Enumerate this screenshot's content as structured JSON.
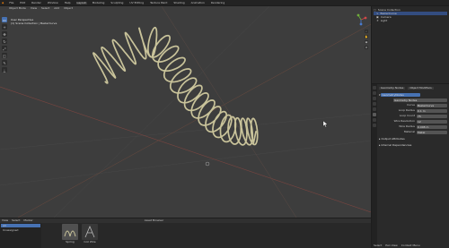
{
  "menu": {
    "items": [
      "File",
      "Edit",
      "Render",
      "Window",
      "Help",
      "Layout",
      "Modeling",
      "Sculpting",
      "UV Editing",
      "Texture Paint",
      "Shading",
      "Animation",
      "Rendering"
    ],
    "active_index": 5
  },
  "viewport": {
    "header_items": [
      "Object Mode",
      "View",
      "Select",
      "Add",
      "Object"
    ],
    "info_line1": "User Perspective",
    "info_line2": "(1) Scene Collection | BezierCurve"
  },
  "outliner": {
    "rows": [
      {
        "label": "Scene Collection",
        "selected": false
      },
      {
        "label": "BezierCurve",
        "selected": true
      },
      {
        "label": "Camera",
        "selected": false
      },
      {
        "label": "Light",
        "selected": false
      }
    ]
  },
  "properties": {
    "top_tabs": [
      "Geometry Nodes",
      "Object Modifiers"
    ],
    "modifier_name": "GeometryNodes",
    "node_group": "Geometry Nodes",
    "inputs": [
      {
        "label": "Curve",
        "value": "BezierCurve"
      },
      {
        "label": "Loop Radius",
        "value": "0.1 m"
      },
      {
        "label": "Loop Count",
        "value": "75"
      },
      {
        "label": "Wire Resolution",
        "value": "12"
      },
      {
        "label": "Wire Radius",
        "value": "0.008 m"
      },
      {
        "label": "Material",
        "value": "Metal"
      }
    ],
    "sections": [
      "Output Attributes",
      "Internal Dependencies"
    ]
  },
  "timeline": {
    "header_items": [
      "View",
      "Select",
      "Marker"
    ],
    "center_label": "Asset Browser",
    "left_items": [
      "All",
      "Unassigned"
    ],
    "assets": [
      "Spring",
      "Coil Wire"
    ]
  },
  "status": {
    "items": [
      "Select",
      "Pan View",
      "Context Menu"
    ]
  },
  "colors": {
    "accent": "#4772b3",
    "viewport_bg": "#3d3d3d",
    "spring_metal": "#c9c39a",
    "grid_axis_red": "#8a4a44"
  }
}
